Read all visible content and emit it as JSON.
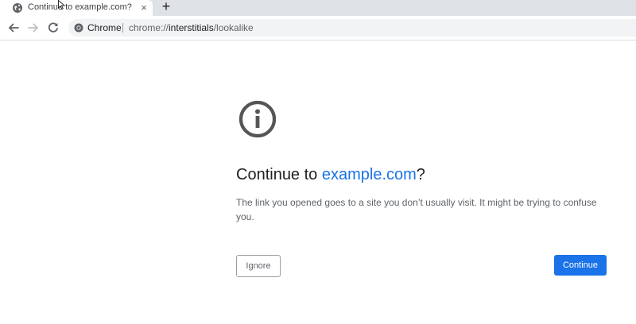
{
  "tab": {
    "title": "Continue to example.com?",
    "favicon": "globe-icon",
    "close_glyph": "×"
  },
  "tabstrip": {
    "new_tab_glyph": "+"
  },
  "toolbar": {
    "back_icon": "back-arrow-icon",
    "forward_icon": "forward-arrow-icon",
    "reload_icon": "reload-icon"
  },
  "omnibox": {
    "chip_icon": "chrome-icon",
    "chip_label": "Chrome",
    "url_scheme": "chrome://",
    "url_host": "interstitials",
    "url_path": "/lookalike"
  },
  "interstitial": {
    "icon": "info-icon",
    "headline_prefix": "Continue to ",
    "headline_domain": "example.com",
    "headline_suffix": "?",
    "body": "The link you opened goes to a site you don’t usually visit. It might be trying to confuse you.",
    "ignore_label": "Ignore",
    "continue_label": "Continue"
  },
  "colors": {
    "accent": "#1a73e8",
    "tabstrip_bg": "#dee1e6",
    "omnibox_bg": "#f1f3f4",
    "icon_gray": "#5f6368",
    "info_icon": "#555555"
  }
}
